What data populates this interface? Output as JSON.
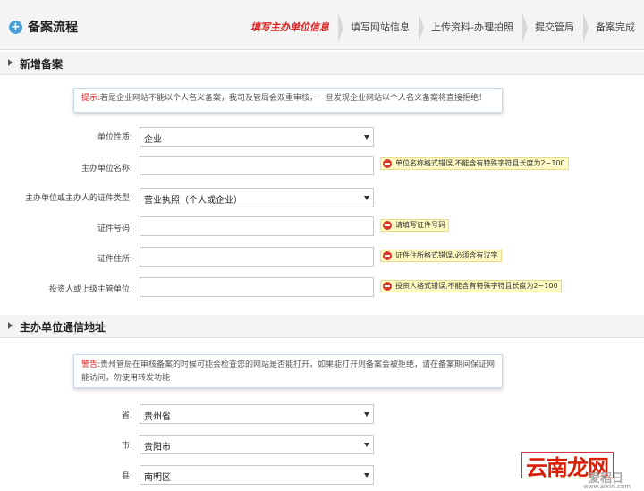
{
  "header": {
    "flow_title": "备案流程",
    "steps": [
      {
        "label": "填写主办单位信息",
        "active": true
      },
      {
        "label": "填写网站信息",
        "active": false
      },
      {
        "label": "上传资料-办理拍照",
        "active": false
      },
      {
        "label": "提交管局",
        "active": false
      },
      {
        "label": "备案完成",
        "active": false
      }
    ]
  },
  "section1": {
    "title": "新增备案",
    "notice": {
      "lead": "提示:",
      "text": "若是企业网站不能以个人名义备案，我司及管局会双重审核，一旦发现企业网站以个人名义备案将直接拒绝！"
    },
    "fields": [
      {
        "label": "单位性质:",
        "type": "select",
        "value": "企业"
      },
      {
        "label": "主办单位名称:",
        "type": "input",
        "value": "",
        "error": "单位名称格式错误,不能含有特殊字符且长度为2~100"
      },
      {
        "label": "主办单位或主办人的证件类型:",
        "type": "select",
        "value": "营业执照（个人或企业）"
      },
      {
        "label": "证件号码:",
        "type": "input",
        "value": "",
        "error": "请填写证件号码"
      },
      {
        "label": "证件住所:",
        "type": "input",
        "value": "",
        "error": "证件住所格式错误,必须含有汉字"
      },
      {
        "label": "投资人或上级主管单位:",
        "type": "input",
        "value": "",
        "error": "投资人格式错误,不能含有特殊字符且长度为2~100"
      }
    ]
  },
  "section2": {
    "title": "主办单位通信地址",
    "notice": {
      "lead": "警告:",
      "line1": "贵州管局在审核备案的时候可能会检查您的网站是否能打开，如果能打开则备案会被拒绝，请在备案期间保证网站不",
      "line2": "能访问，勿使用转发功能"
    },
    "fields": [
      {
        "label": "省:",
        "type": "select",
        "value": "贵州省"
      },
      {
        "label": "市:",
        "type": "select",
        "value": "贵阳市"
      },
      {
        "label": "县:",
        "type": "select",
        "value": "南明区"
      }
    ]
  },
  "watermark": {
    "main": "云南龙网",
    "side": "爱稻日",
    "url": "www.aixiri.com"
  }
}
